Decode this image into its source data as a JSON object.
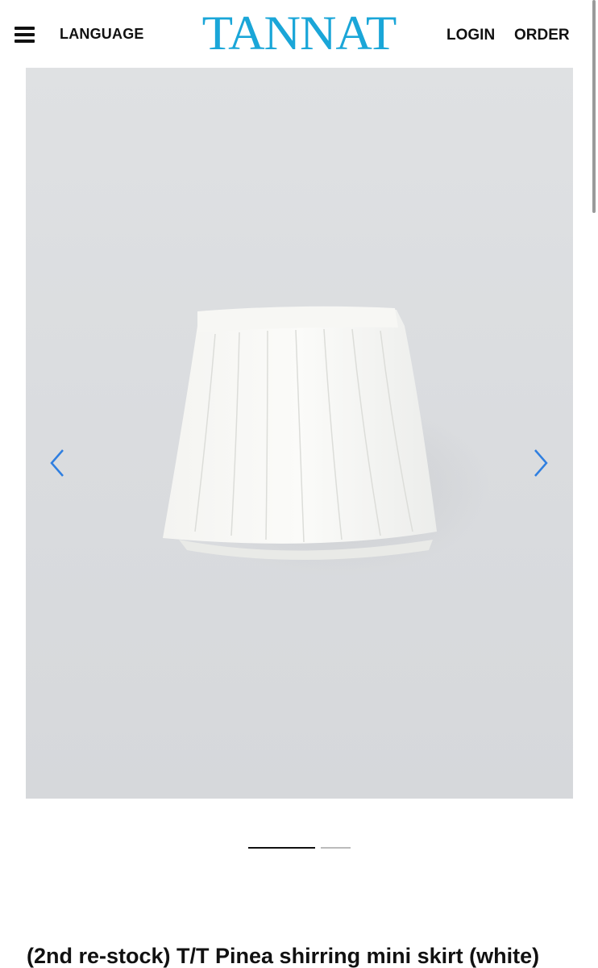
{
  "header": {
    "language_label": "LANGUAGE",
    "logo_text": "TANNAT",
    "login_label": "LOGIN",
    "order_label": "ORDER",
    "logo_color": "#1aa6d8"
  },
  "icons": {
    "menu": "hamburger-menu-icon",
    "prev": "chevron-left-icon",
    "next": "chevron-right-icon"
  },
  "gallery": {
    "current_slide": 1,
    "slide_count": 2,
    "arrow_color": "#2f7fe0"
  },
  "product": {
    "title": "(2nd re-stock) T/T Pinea shirring mini skirt (white)"
  }
}
